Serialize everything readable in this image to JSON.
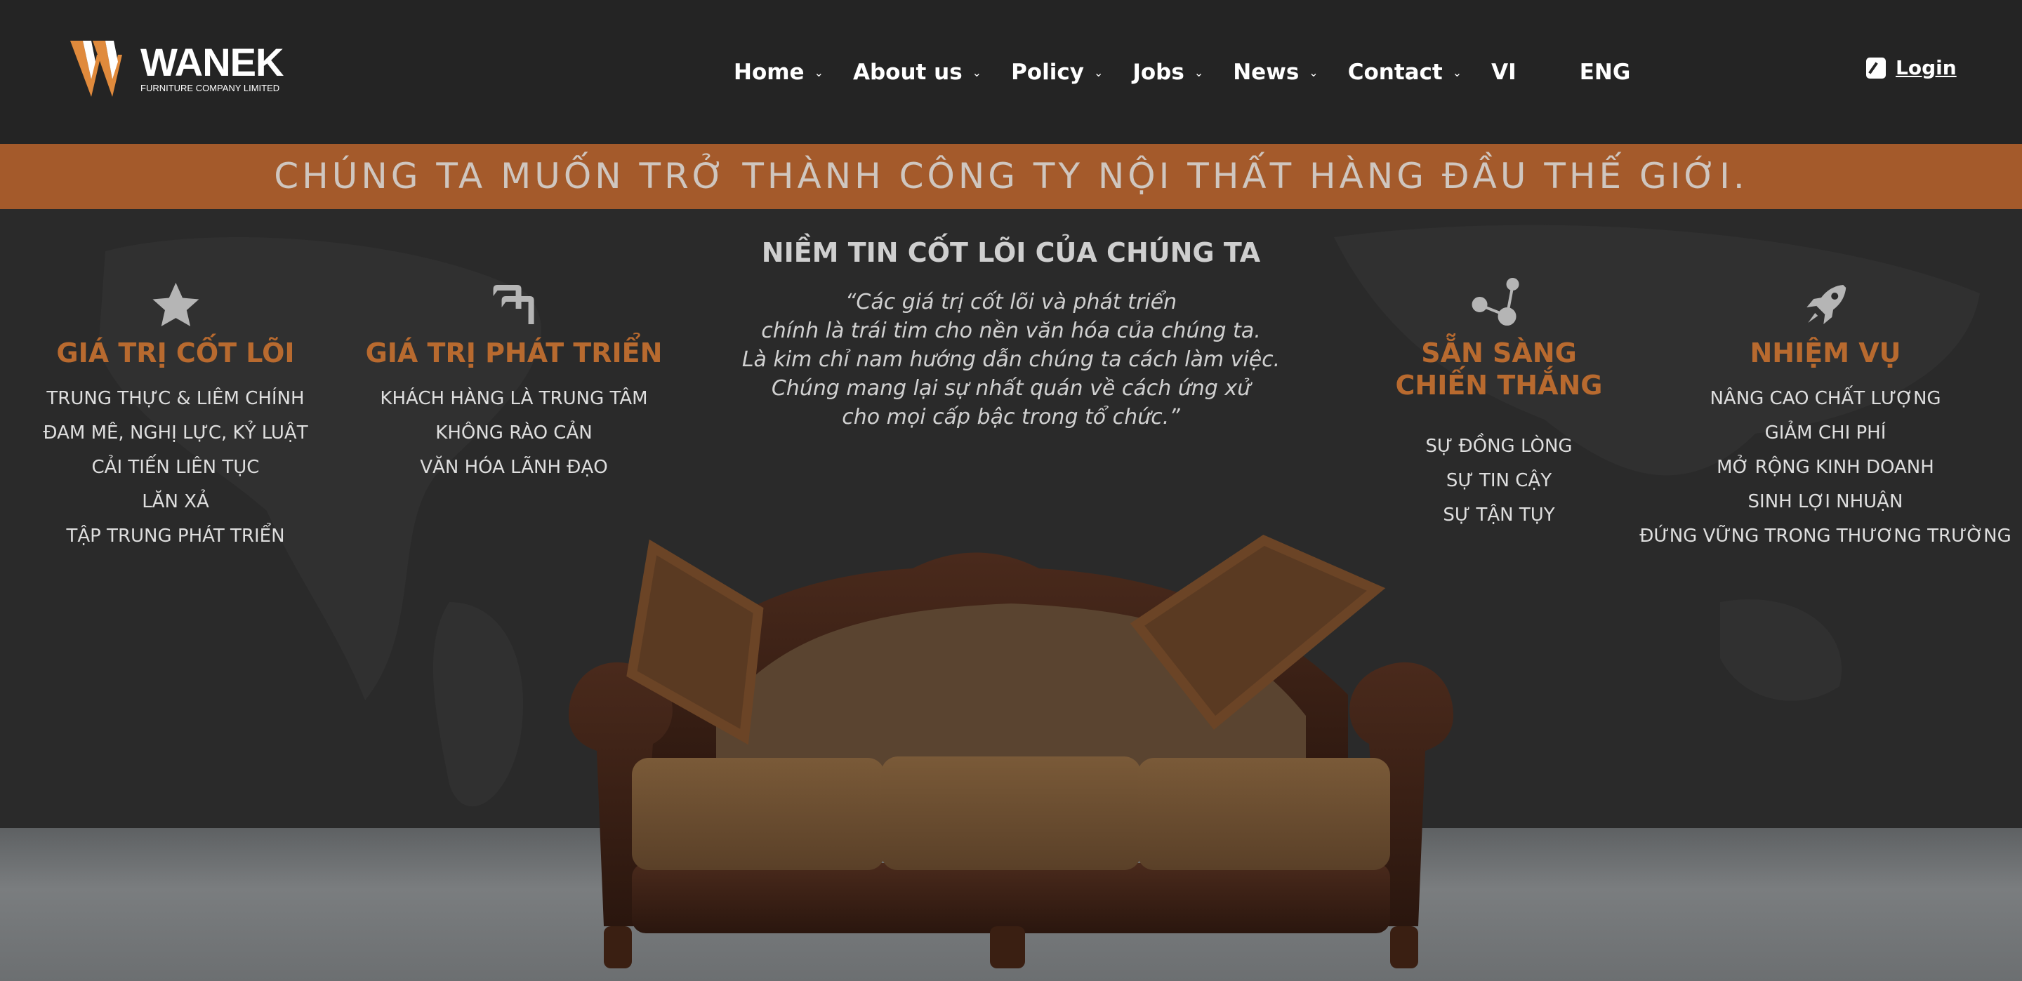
{
  "header": {
    "logo": {
      "brand": "WANEK",
      "tagline": "FURNITURE COMPANY LIMITED"
    },
    "nav": [
      {
        "label": "Home",
        "dropdown": true
      },
      {
        "label": "About us",
        "dropdown": true
      },
      {
        "label": "Policy",
        "dropdown": true
      },
      {
        "label": "Jobs",
        "dropdown": true
      },
      {
        "label": "News",
        "dropdown": true
      },
      {
        "label": "Contact",
        "dropdown": true
      },
      {
        "label": "VI",
        "dropdown": false
      },
      {
        "label": "ENG",
        "dropdown": false
      }
    ],
    "login": {
      "label": "Login",
      "icon": "login-icon"
    }
  },
  "banner": {
    "text": "CHÚNG TA MUỐN TRỞ THÀNH CÔNG TY NỘI THẤT HÀNG ĐẦU THẾ GIỚI."
  },
  "core": {
    "title": "NIỀM TIN CỐT LÕI CỦA CHÚNG TA",
    "quote": [
      "“Các giá trị cốt lõi và phát triển",
      "chính là trái tim cho nền văn hóa của chúng ta.",
      "Là kim chỉ nam hướng dẫn chúng ta cách làm việc.",
      "Chúng mang lại sự nhất quán về cách ứng xử",
      "cho mọi cấp bậc trong tổ chức.”"
    ]
  },
  "columns": [
    {
      "icon": "star-icon",
      "title": [
        "GIÁ TRỊ CỐT LÕI"
      ],
      "items": [
        "TRUNG THỰC & LIÊM CHÍNH",
        "ĐAM MÊ, NGHỊ LỰC, KỶ LUẬT",
        "CẢI TIẾN LIÊN TỤC",
        "LĂN XẢ",
        "TẬP TRUNG PHÁT TRIỂN"
      ]
    },
    {
      "icon": "growth-arrows-icon",
      "title": [
        "GIÁ TRỊ PHÁT TRIỂN"
      ],
      "items": [
        "KHÁCH HÀNG LÀ TRUNG TÂM",
        "KHÔNG RÀO CẢN",
        "VĂN HÓA LÃNH ĐẠO"
      ]
    },
    {
      "icon": "molecule-icon",
      "title": [
        "SẴN SÀNG",
        "CHIẾN THẮNG"
      ],
      "items": [
        "SỰ ĐỒNG LÒNG",
        "SỰ TIN CẬY",
        "SỰ TẬN TỤY"
      ]
    },
    {
      "icon": "rocket-icon",
      "title": [
        "NHIỆM VỤ"
      ],
      "items": [
        "NÂNG CAO CHẤT LƯỢNG",
        "GIẢM CHI PHÍ",
        "MỞ RỘNG KINH DOANH",
        "SINH LỢI NHUẬN",
        "ĐỨNG VỮNG TRONG THƯƠNG TRƯỜNG"
      ]
    }
  ],
  "colors": {
    "accent": "#b86a2f",
    "banner": "#a45a2b",
    "background": "#2a2a2a",
    "header": "#242424"
  }
}
